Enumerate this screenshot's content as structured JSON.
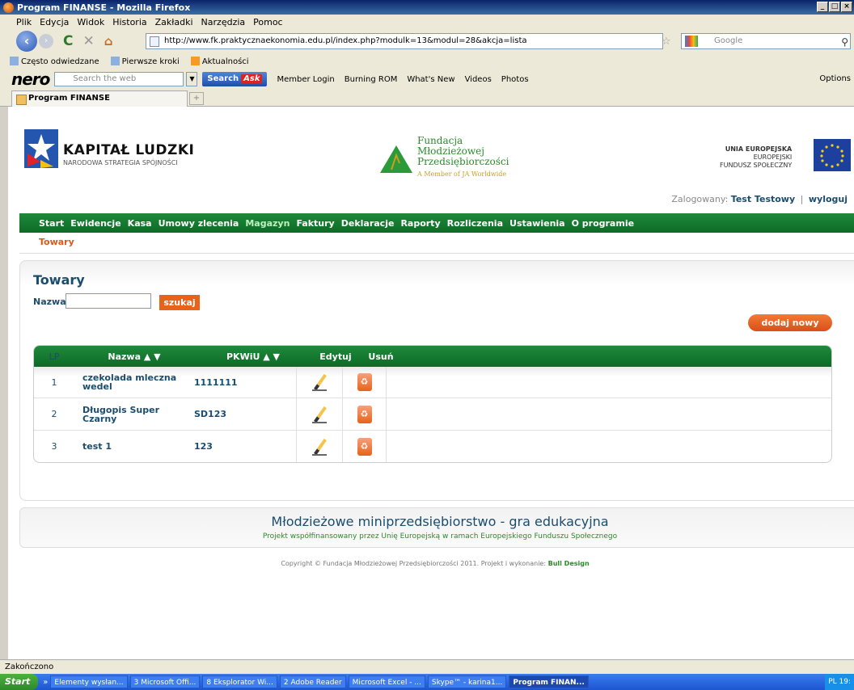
{
  "window": {
    "title": "Program FINANSE - Mozilla Firefox",
    "buttons": [
      "_",
      "□",
      "×"
    ]
  },
  "menu": [
    "Plik",
    "Edycja",
    "Widok",
    "Historia",
    "Zakładki",
    "Narzędzia",
    "Pomoc"
  ],
  "nav": {
    "url": "http://www.fk.praktycznaekonomia.edu.pl/index.php?modulk=13&modul=28&akcja=lista",
    "search_placeholder": "Google"
  },
  "bookmarks": [
    "Często odwiedzane",
    "Pierwsze kroki",
    "Aktualności"
  ],
  "nero": {
    "logo": "nero",
    "search_placeholder": "Search the web",
    "search_button": "Search",
    "ask": "Ask",
    "items": [
      "Member Login",
      "Burning ROM",
      "What's New",
      "Videos",
      "Photos"
    ],
    "options": "Options"
  },
  "tab": {
    "title": "Program FINANSE",
    "new_tab": "+"
  },
  "logos": {
    "kl_title": "KAPITAŁ LUDZKI",
    "kl_sub": "NARODOWA STRATEGIA SPÓJNOŚCI",
    "fm_line1": "Fundacja",
    "fm_line2": "Młodzieżowej",
    "fm_line3": "Przedsiębiorczości",
    "fm_member": "A Member of JA Worldwide",
    "ue_line1": "UNIA EUROPEJSKA",
    "ue_line2": "EUROPEJSKI",
    "ue_line3": "FUNDUSZ SPOŁECZNY"
  },
  "login": {
    "label": "Zalogowany:",
    "user": "Test Testowy",
    "sep": "|",
    "logout": "wyloguj"
  },
  "mainnav": [
    "Start",
    "Ewidencje",
    "Kasa",
    "Umowy zlecenia",
    "Magazyn",
    "Faktury",
    "Deklaracje",
    "Raporty",
    "Rozliczenia",
    "Ustawienia",
    "O programie"
  ],
  "subnav": "Towary",
  "page": {
    "title": "Towary",
    "search_label": "Nazwa:",
    "search_value": "",
    "search_button": "szukaj",
    "add_button": "dodaj nowy"
  },
  "table": {
    "headers": {
      "lp": "LP",
      "nazwa": "Nazwa ▲ ▼",
      "pkwiu": "PKWiU ▲ ▼",
      "edit": "Edytuj",
      "delete": "Usuń"
    },
    "rows": [
      {
        "lp": "1",
        "nazwa": "czekolada mleczna wedel",
        "pkwiu": "1111111"
      },
      {
        "lp": "2",
        "nazwa": "Długopis Super Czarny",
        "pkwiu": "SD123"
      },
      {
        "lp": "3",
        "nazwa": "test 1",
        "pkwiu": "123"
      }
    ]
  },
  "footer": {
    "title": "Młodzieżowe miniprzedsiębiorstwo - gra edukacyjna",
    "sub": "Projekt współfinansowany przez Unię Europejską w ramach Europejskiego Funduszu Społecznego",
    "copyright": "Copyright © Fundacja Młodzieżowej Przedsiębiorczości 2011. Projekt i wykonanie:",
    "author": "Bull Design"
  },
  "status": "Zakończono",
  "taskbar": {
    "start": "Start",
    "quicklaunch_more": "»",
    "items": [
      "Elementy wysłan...",
      "3 Microsoft Offi...",
      "8 Eksplorator Wi...",
      "2 Adobe Reader",
      "Microsoft Excel - ...",
      "Skype™ - karina1...",
      "Program FINAN..."
    ],
    "lang": "PL",
    "clock": "19:"
  }
}
